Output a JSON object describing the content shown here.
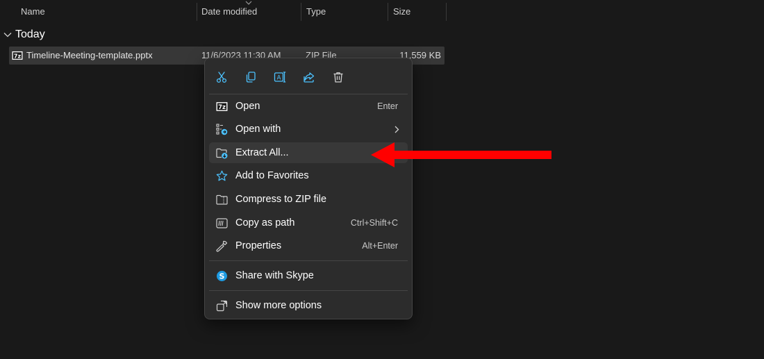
{
  "columns": {
    "name": "Name",
    "date": "Date modified",
    "type": "Type",
    "size": "Size"
  },
  "group": {
    "label": "Today"
  },
  "file": {
    "name": "Timeline-Meeting-template.pptx",
    "date": "11/6/2023 11:30 AM",
    "type": "ZIP File",
    "size": "11,559 KB",
    "icon": "7z-archive-icon"
  },
  "context_menu": {
    "toolbar": [
      {
        "name": "cut",
        "icon": "scissors-icon"
      },
      {
        "name": "copy",
        "icon": "copy-icon"
      },
      {
        "name": "rename",
        "icon": "rename-icon"
      },
      {
        "name": "share",
        "icon": "share-icon"
      },
      {
        "name": "delete",
        "icon": "trash-icon"
      }
    ],
    "items": [
      {
        "label": "Open",
        "shortcut": "Enter",
        "icon": "7z-archive-icon"
      },
      {
        "label": "Open with",
        "shortcut": "",
        "icon": "open-with-icon",
        "submenu": true
      },
      {
        "label": "Extract All...",
        "shortcut": "",
        "icon": "extract-folder-icon",
        "highlighted": true
      },
      {
        "label": "Add to Favorites",
        "shortcut": "",
        "icon": "star-icon"
      },
      {
        "label": "Compress to ZIP file",
        "shortcut": "",
        "icon": "zip-folder-icon"
      },
      {
        "label": "Copy as path",
        "shortcut": "Ctrl+Shift+C",
        "icon": "copy-path-icon"
      },
      {
        "label": "Properties",
        "shortcut": "Alt+Enter",
        "icon": "wrench-icon"
      },
      {
        "label": "Share with Skype",
        "shortcut": "",
        "icon": "skype-icon"
      },
      {
        "label": "Show more options",
        "shortcut": "",
        "icon": "more-options-icon"
      }
    ]
  },
  "annotation": {
    "icon": "red-arrow-pointer",
    "color": "#ff0000"
  },
  "colors": {
    "background": "#191919",
    "menu_bg": "#2c2c2c",
    "accent": "#4cc2ff",
    "selected_row": "#373737"
  }
}
